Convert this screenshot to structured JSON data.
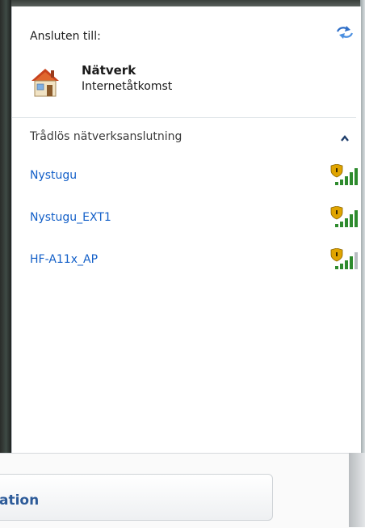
{
  "header": {
    "connected_label": "Ansluten till:",
    "refresh_icon": "refresh-arrows-icon"
  },
  "current_network": {
    "icon": "house-network-icon",
    "name": "Nätverk",
    "status": "Internetåtkomst"
  },
  "wireless_section": {
    "label": "Trådlös nätverksanslutning",
    "collapse_icon": "chevron-up-icon"
  },
  "networks": [
    {
      "name": "Nystugu",
      "secured": true,
      "signal_bars": 5
    },
    {
      "name": "Nystugu_EXT1",
      "secured": true,
      "signal_bars": 5
    },
    {
      "name": "HF-A11x_AP",
      "secured": true,
      "signal_bars": 4
    }
  ],
  "bottom_button": {
    "label": "ation"
  },
  "colors": {
    "link": "#1460c8",
    "signal_on": "#2e8b2e",
    "signal_off": "#b6bcc0",
    "shield": "#e0a400",
    "chevron": "#1f3e6b"
  }
}
